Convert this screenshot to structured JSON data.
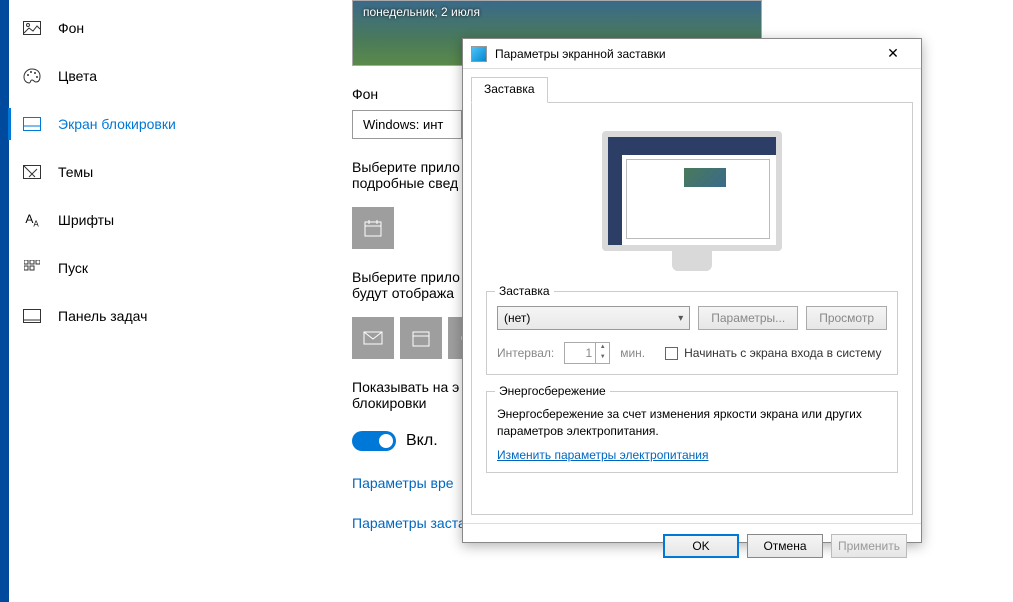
{
  "sidebar": {
    "items": [
      {
        "label": "Фон"
      },
      {
        "label": "Цвета"
      },
      {
        "label": "Экран блокировки"
      },
      {
        "label": "Темы"
      },
      {
        "label": "Шрифты"
      },
      {
        "label": "Пуск"
      },
      {
        "label": "Панель задач"
      }
    ]
  },
  "main": {
    "hero_date": "понедельник, 2 июля",
    "bg_label": "Фон",
    "bg_value": "Windows: инт",
    "app1_label": "Выберите прило",
    "app1_sub": "подробные свед",
    "app2_label": "Выберите прило",
    "app2_sub": "будут отобража",
    "show_label_a": "Показывать на э",
    "show_label_b": "блокировки",
    "toggle_text": "Вкл.",
    "link_time": "Параметры вре",
    "link_saver": "Параметры заставки"
  },
  "dlg": {
    "title": "Параметры экранной заставки",
    "tab": "Заставка",
    "grp1": "Заставка",
    "sel_value": "(нет)",
    "btn_params": "Параметры...",
    "btn_preview": "Просмотр",
    "interval_label": "Интервал:",
    "interval_value": "1",
    "interval_unit": "мин.",
    "chk_label": "Начинать с экрана входа в систему",
    "grp2": "Энергосбережение",
    "power_desc": "Энергосбережение за счет изменения яркости экрана или других параметров электропитания.",
    "power_link": "Изменить параметры электропитания",
    "ok": "OK",
    "cancel": "Отмена",
    "apply": "Применить"
  }
}
